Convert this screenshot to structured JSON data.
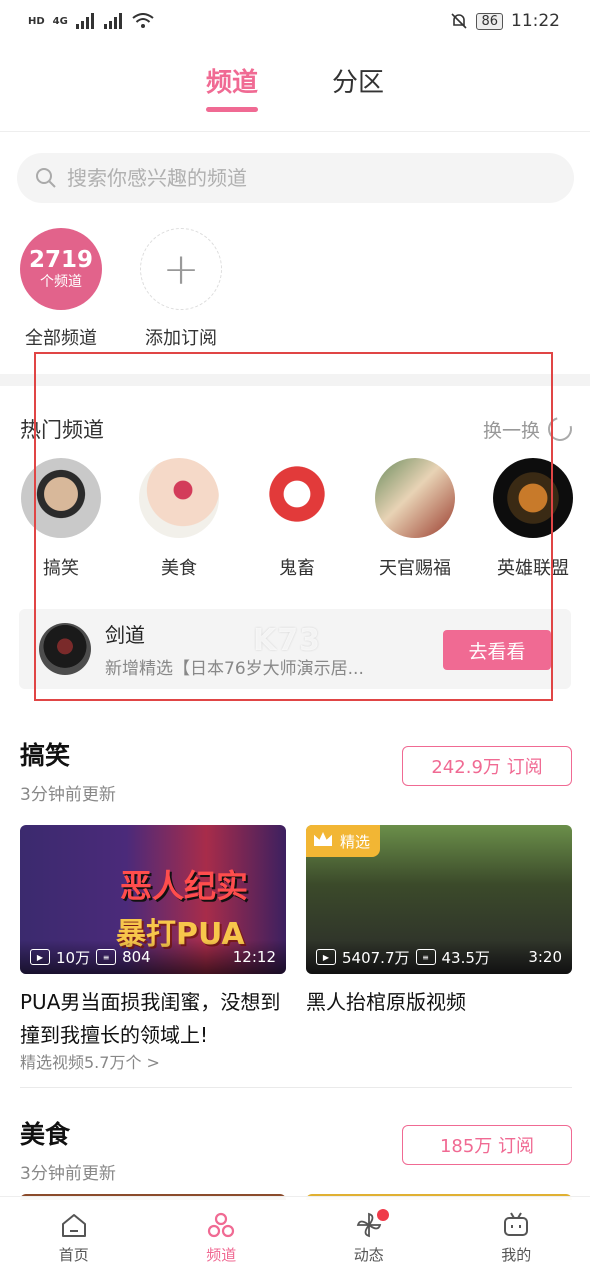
{
  "status_bar": {
    "network_left": "HD",
    "network_right": "4G",
    "battery": "86",
    "time": "11:22"
  },
  "top_tabs": [
    {
      "label": "频道",
      "active": true
    },
    {
      "label": "分区",
      "active": false
    }
  ],
  "search": {
    "placeholder": "搜索你感兴趣的频道"
  },
  "subscriptions": {
    "count": "2719",
    "count_unit": "个频道",
    "all_label": "全部频道",
    "add_label": "添加订阅"
  },
  "hot": {
    "title": "热门频道",
    "shuffle": "换一换",
    "channels": [
      {
        "label": "搞笑"
      },
      {
        "label": "美食"
      },
      {
        "label": "鬼畜"
      },
      {
        "label": "天官赐福"
      },
      {
        "label": "英雄联盟"
      }
    ]
  },
  "featured": {
    "title": "剑道",
    "desc": "新增精选【日本76岁大师演示居...",
    "button": "去看看",
    "watermark": "K73"
  },
  "sections": [
    {
      "title": "搞笑",
      "updated": "3分钟前更新",
      "subscribe": "242.9万 订阅",
      "videos": [
        {
          "plays": "10万",
          "danmaku": "804",
          "duration": "12:12",
          "headline1": "恶人纪实",
          "headline2": "暴打PUA",
          "title": "PUA男当面损我闺蜜，没想到撞到我擅长的领域上!"
        },
        {
          "badge": "精选",
          "plays": "5407.7万",
          "danmaku": "43.5万",
          "duration": "3:20",
          "title": "黑人抬棺原版视频"
        }
      ],
      "more": "精选视频5.7万个 >"
    },
    {
      "title": "美食",
      "updated": "3分钟前更新",
      "subscribe": "185万 订阅"
    }
  ],
  "bottom_nav": [
    {
      "label": "首页",
      "icon": "home-icon",
      "active": false
    },
    {
      "label": "频道",
      "icon": "channel-icon",
      "active": true
    },
    {
      "label": "动态",
      "icon": "pinwheel-icon",
      "active": false
    },
    {
      "label": "我的",
      "icon": "tv-icon",
      "active": false
    }
  ],
  "colors": {
    "accent": "#f06a93",
    "badge": "#f2b634"
  }
}
